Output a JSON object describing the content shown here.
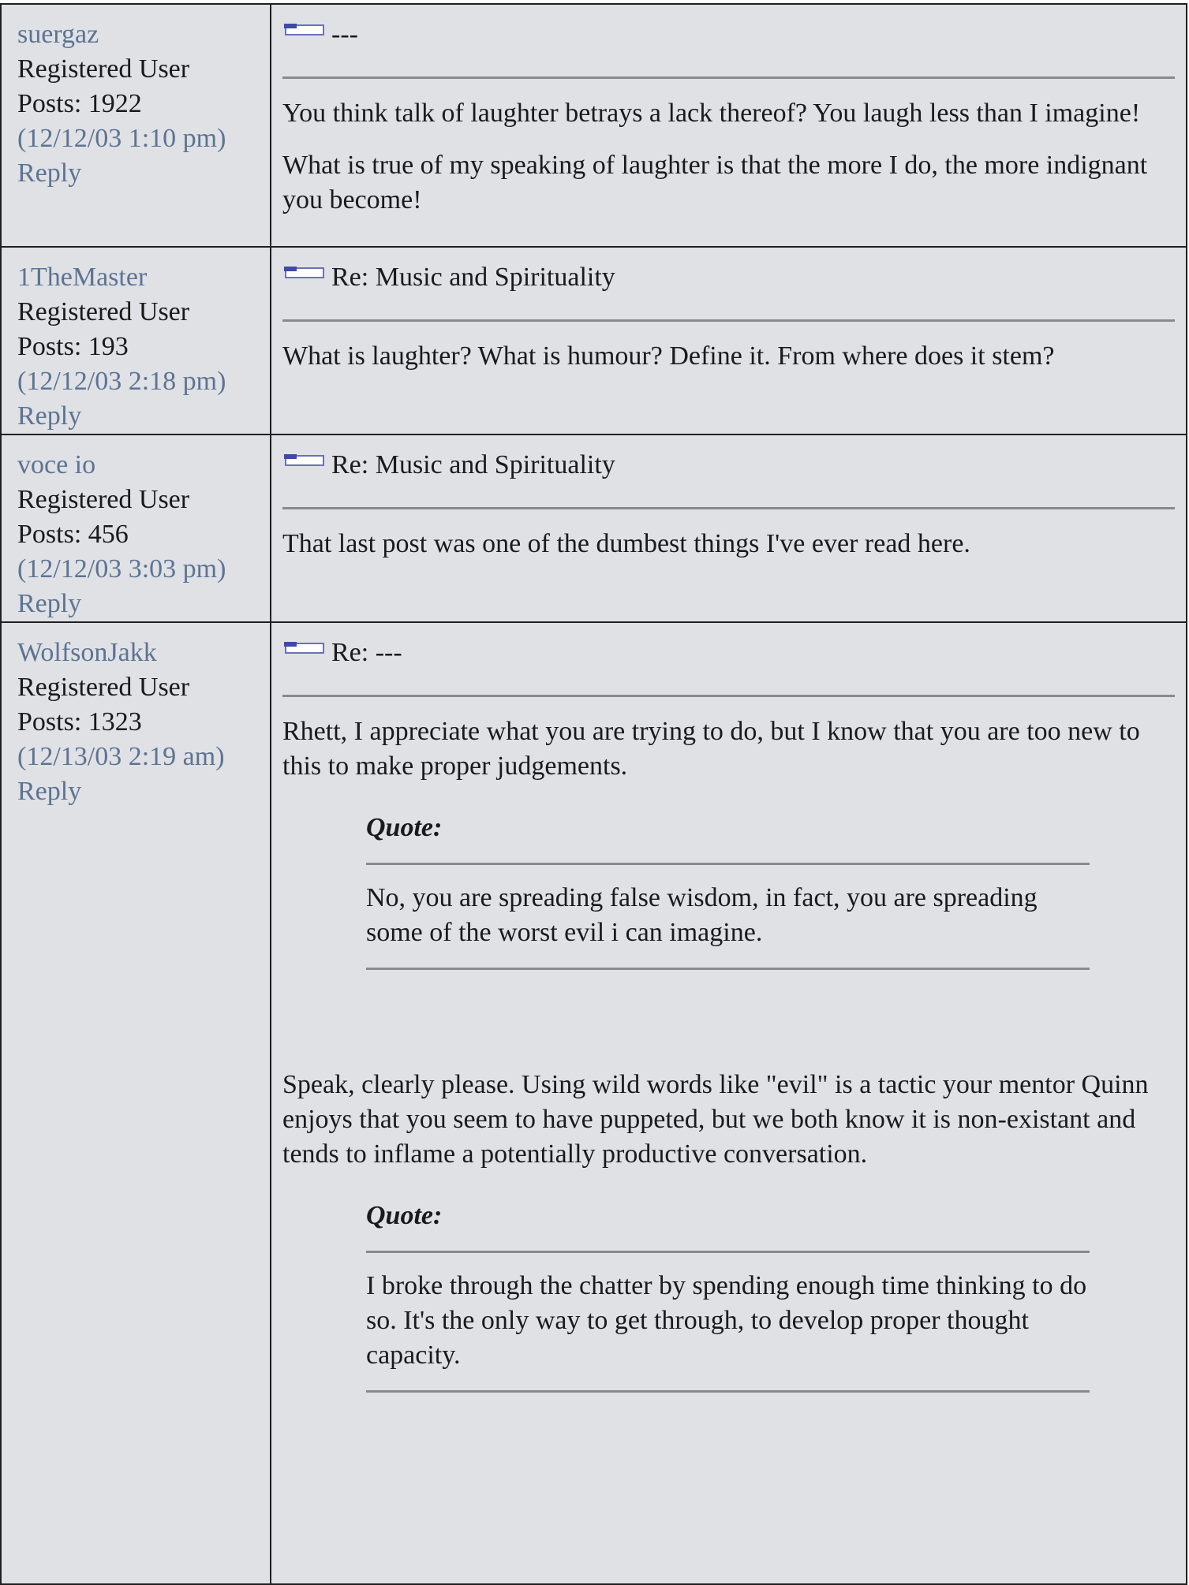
{
  "posts": [
    {
      "author": "suergaz",
      "role": "Registered User",
      "posts": "Posts: 1922",
      "date": "(12/12/03 1:10 pm)",
      "reply": "Reply",
      "subject": "---",
      "body": [
        "You think talk of laughter betrays a lack thereof? You laugh less than I imagine!",
        "What is true of my speaking of laughter is that the more I do, the more indignant you become!"
      ]
    },
    {
      "author": "1TheMaster",
      "role": "Registered User",
      "posts": "Posts: 193",
      "date": "(12/12/03 2:18 pm)",
      "reply": "Reply",
      "subject": "Re: Music and Spirituality",
      "body": [
        "What is laughter? What is humour? Define it. From where does it stem?"
      ]
    },
    {
      "author": "voce io",
      "role": "Registered User",
      "posts": "Posts: 456",
      "date": "(12/12/03 3:03 pm)",
      "reply": "Reply",
      "subject": "Re: Music and Spirituality",
      "body": [
        "That last post was one of the dumbest things I've ever read here."
      ]
    },
    {
      "author": "WolfsonJakk",
      "role": "Registered User",
      "posts": "Posts: 1323",
      "date": "(12/13/03 2:19 am)",
      "reply": "Reply",
      "subject": "Re: ---",
      "body_intro": "Rhett, I appreciate what you are trying to do, but I know that you are too new to this to make proper judgements.",
      "quote1_label": "Quote:",
      "quote1_text": "No, you are spreading false wisdom, in fact, you are spreading some of the worst evil i can imagine.",
      "body_middle": "Speak, clearly please. Using wild words like \"evil\" is a tactic your mentor Quinn enjoys that you seem to have puppeted, but we both know it is non-existant and tends to inflame a potentially productive conversation.",
      "quote2_label": "Quote:",
      "quote2_text": "I broke through the chatter by spending enough time thinking to do so. It's the only way to get through, to develop proper thought capacity."
    }
  ],
  "icons": {
    "post_icon": "post-icon"
  },
  "colors": {
    "cell_bg": "#dfe1e5",
    "link": "#5d7393",
    "border": "#1f1f1f",
    "rule": "#8a8a8a"
  }
}
